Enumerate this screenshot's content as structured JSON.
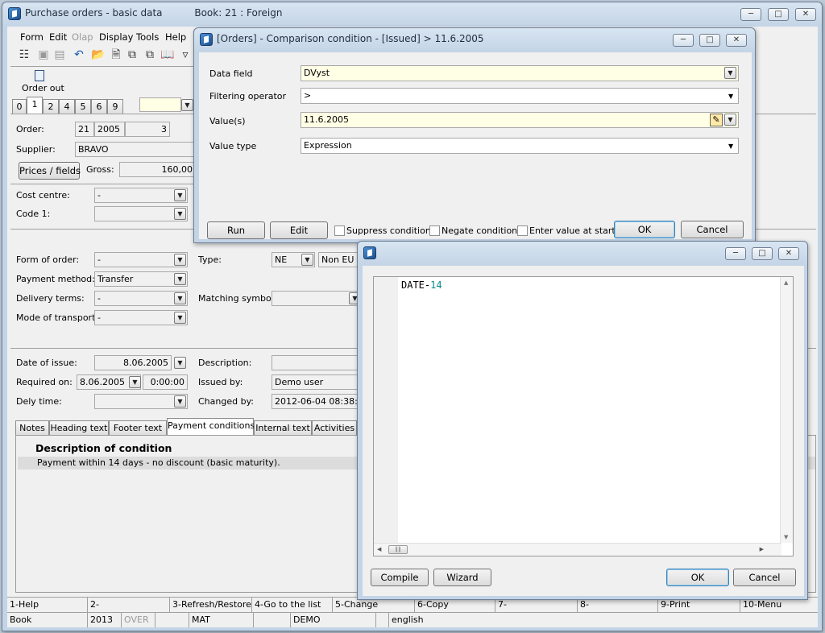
{
  "main": {
    "title": "Purchase orders - basic data",
    "book": "Book: 21 : Foreign",
    "menu": [
      "Form",
      "Edit",
      "Olap",
      "Display",
      "Tools",
      "Help"
    ],
    "order_out_label": "Order out",
    "page_tabs": [
      "0",
      "1",
      "2",
      "4",
      "5",
      "6",
      "9"
    ],
    "order_label": "Order:",
    "order_book": "21",
    "order_year": "2005",
    "order_number": "3",
    "supplier_label": "Supplier:",
    "supplier_value": "BRAVO",
    "prices_button": "Prices / fields",
    "gross_label": "Gross:",
    "gross_value": "160,00",
    "cost_centre_label": "Cost centre:",
    "cost_centre_value": "-",
    "code1_label": "Code 1:",
    "form_of_order_label": "Form of order:",
    "form_of_order_value": "-",
    "payment_method_label": "Payment method:",
    "payment_method_value": "Transfer",
    "delivery_terms_label": "Delivery terms:",
    "delivery_terms_value": "-",
    "mode_transport_label": "Mode of transport:",
    "mode_transport_value": "-",
    "type_label": "Type:",
    "type_value": "NE",
    "type_desc": "Non EU",
    "matching_symbol_label": "Matching symbol:",
    "date_issue_label": "Date of issue:",
    "date_issue_value": "8.06.2005",
    "required_on_label": "Required on:",
    "required_on_date": "8.06.2005",
    "required_on_time": "0:00:00",
    "delivery_time_label": "Dely time:",
    "description_label": "Description:",
    "issued_by_label": "Issued by:",
    "issued_by_value": "Demo user",
    "changed_by_label": "Changed by:",
    "changed_by_value": "2012-06-04 08:38:15",
    "bottom_tabs": [
      "Notes",
      "Heading text",
      "Footer text",
      "Payment conditions",
      "Internal text",
      "Activities"
    ],
    "grid_header": "Description of condition",
    "grid_row": "Payment within 14 days - no discount (basic maturity).",
    "fkeys": [
      "1-Help",
      "2-",
      "3-Refresh/Restore",
      "4-Go to the list",
      "5-Change",
      "6-Copy",
      "7-",
      "8-",
      "9-Print",
      "10-Menu"
    ],
    "status": [
      "Book",
      "2013",
      "OVER",
      "",
      "MAT",
      "",
      "DEMO",
      "",
      "english"
    ]
  },
  "cond_dialog": {
    "title": "[Orders] - Comparison condition - [Issued] > 11.6.2005",
    "data_field_label": "Data field",
    "data_field_value": "DVyst",
    "operator_label": "Filtering operator",
    "operator_value": ">",
    "values_label": "Value(s)",
    "values_value": "11.6.2005",
    "value_type_label": "Value type",
    "value_type_value": "Expression",
    "run_button": "Run",
    "edit_button": "Edit",
    "suppress_label": "Suppress condition",
    "negate_label": "Negate condition",
    "enter_start_label": "Enter value at start",
    "ok_button": "OK",
    "cancel_button": "Cancel"
  },
  "expr_dialog": {
    "code_keyword": "DATE",
    "code_op": "-",
    "code_num": "14",
    "compile_button": "Compile",
    "wizard_button": "Wizard",
    "ok_button": "OK",
    "cancel_button": "Cancel"
  },
  "colors": {
    "yellow_field": "#ffffe6",
    "code_number": "#0a8a8a",
    "window_frame": "#c3d4e6"
  }
}
